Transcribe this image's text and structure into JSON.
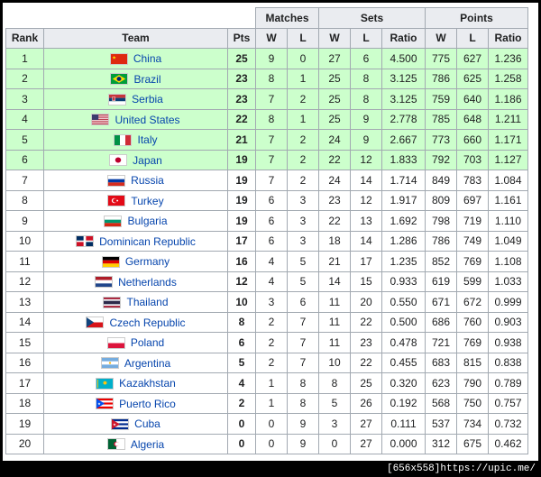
{
  "headers": {
    "matches": "Matches",
    "sets": "Sets",
    "points": "Points",
    "rank": "Rank",
    "team": "Team",
    "pts": "Pts",
    "w": "W",
    "l": "L",
    "ratio": "Ratio"
  },
  "qualified_color": "#ccffcc",
  "rows": [
    {
      "rank": "1",
      "team": "China",
      "flag": "flag-china-icon",
      "pts": "25",
      "mw": "9",
      "ml": "0",
      "sw": "27",
      "sl": "6",
      "sr": "4.500",
      "pw": "775",
      "pl": "627",
      "pr": "1.236"
    },
    {
      "rank": "2",
      "team": "Brazil",
      "flag": "flag-brazil-icon",
      "pts": "23",
      "mw": "8",
      "ml": "1",
      "sw": "25",
      "sl": "8",
      "sr": "3.125",
      "pw": "786",
      "pl": "625",
      "pr": "1.258"
    },
    {
      "rank": "3",
      "team": "Serbia",
      "flag": "flag-serbia-icon",
      "pts": "23",
      "mw": "7",
      "ml": "2",
      "sw": "25",
      "sl": "8",
      "sr": "3.125",
      "pw": "759",
      "pl": "640",
      "pr": "1.186"
    },
    {
      "rank": "4",
      "team": "United States",
      "flag": "flag-united-states-icon",
      "pts": "22",
      "mw": "8",
      "ml": "1",
      "sw": "25",
      "sl": "9",
      "sr": "2.778",
      "pw": "785",
      "pl": "648",
      "pr": "1.211"
    },
    {
      "rank": "5",
      "team": "Italy",
      "flag": "flag-italy-icon",
      "pts": "21",
      "mw": "7",
      "ml": "2",
      "sw": "24",
      "sl": "9",
      "sr": "2.667",
      "pw": "773",
      "pl": "660",
      "pr": "1.171"
    },
    {
      "rank": "6",
      "team": "Japan",
      "flag": "flag-japan-icon",
      "pts": "19",
      "mw": "7",
      "ml": "2",
      "sw": "22",
      "sl": "12",
      "sr": "1.833",
      "pw": "792",
      "pl": "703",
      "pr": "1.127"
    },
    {
      "rank": "7",
      "team": "Russia",
      "flag": "flag-russia-icon",
      "pts": "19",
      "mw": "7",
      "ml": "2",
      "sw": "24",
      "sl": "14",
      "sr": "1.714",
      "pw": "849",
      "pl": "783",
      "pr": "1.084"
    },
    {
      "rank": "8",
      "team": "Turkey",
      "flag": "flag-turkey-icon",
      "pts": "19",
      "mw": "6",
      "ml": "3",
      "sw": "23",
      "sl": "12",
      "sr": "1.917",
      "pw": "809",
      "pl": "697",
      "pr": "1.161"
    },
    {
      "rank": "9",
      "team": "Bulgaria",
      "flag": "flag-bulgaria-icon",
      "pts": "19",
      "mw": "6",
      "ml": "3",
      "sw": "22",
      "sl": "13",
      "sr": "1.692",
      "pw": "798",
      "pl": "719",
      "pr": "1.110"
    },
    {
      "rank": "10",
      "team": "Dominican Republic",
      "flag": "flag-dominican-republic-icon",
      "pts": "17",
      "mw": "6",
      "ml": "3",
      "sw": "18",
      "sl": "14",
      "sr": "1.286",
      "pw": "786",
      "pl": "749",
      "pr": "1.049"
    },
    {
      "rank": "11",
      "team": "Germany",
      "flag": "flag-germany-icon",
      "pts": "16",
      "mw": "4",
      "ml": "5",
      "sw": "21",
      "sl": "17",
      "sr": "1.235",
      "pw": "852",
      "pl": "769",
      "pr": "1.108"
    },
    {
      "rank": "12",
      "team": "Netherlands",
      "flag": "flag-netherlands-icon",
      "pts": "12",
      "mw": "4",
      "ml": "5",
      "sw": "14",
      "sl": "15",
      "sr": "0.933",
      "pw": "619",
      "pl": "599",
      "pr": "1.033"
    },
    {
      "rank": "13",
      "team": "Thailand",
      "flag": "flag-thailand-icon",
      "pts": "10",
      "mw": "3",
      "ml": "6",
      "sw": "11",
      "sl": "20",
      "sr": "0.550",
      "pw": "671",
      "pl": "672",
      "pr": "0.999"
    },
    {
      "rank": "14",
      "team": "Czech Republic",
      "flag": "flag-czech-republic-icon",
      "pts": "8",
      "mw": "2",
      "ml": "7",
      "sw": "11",
      "sl": "22",
      "sr": "0.500",
      "pw": "686",
      "pl": "760",
      "pr": "0.903"
    },
    {
      "rank": "15",
      "team": "Poland",
      "flag": "flag-poland-icon",
      "pts": "6",
      "mw": "2",
      "ml": "7",
      "sw": "11",
      "sl": "23",
      "sr": "0.478",
      "pw": "721",
      "pl": "769",
      "pr": "0.938"
    },
    {
      "rank": "16",
      "team": "Argentina",
      "flag": "flag-argentina-icon",
      "pts": "5",
      "mw": "2",
      "ml": "7",
      "sw": "10",
      "sl": "22",
      "sr": "0.455",
      "pw": "683",
      "pl": "815",
      "pr": "0.838"
    },
    {
      "rank": "17",
      "team": "Kazakhstan",
      "flag": "flag-kazakhstan-icon",
      "pts": "4",
      "mw": "1",
      "ml": "8",
      "sw": "8",
      "sl": "25",
      "sr": "0.320",
      "pw": "623",
      "pl": "790",
      "pr": "0.789"
    },
    {
      "rank": "18",
      "team": "Puerto Rico",
      "flag": "flag-puerto-rico-icon",
      "pts": "2",
      "mw": "1",
      "ml": "8",
      "sw": "5",
      "sl": "26",
      "sr": "0.192",
      "pw": "568",
      "pl": "750",
      "pr": "0.757"
    },
    {
      "rank": "19",
      "team": "Cuba",
      "flag": "flag-cuba-icon",
      "pts": "0",
      "mw": "0",
      "ml": "9",
      "sw": "3",
      "sl": "27",
      "sr": "0.111",
      "pw": "537",
      "pl": "734",
      "pr": "0.732"
    },
    {
      "rank": "20",
      "team": "Algeria",
      "flag": "flag-algeria-icon",
      "pts": "0",
      "mw": "0",
      "ml": "9",
      "sw": "0",
      "sl": "27",
      "sr": "0.000",
      "pw": "312",
      "pl": "675",
      "pr": "0.462"
    }
  ],
  "watermark": "[656x558]https://upic.me/"
}
